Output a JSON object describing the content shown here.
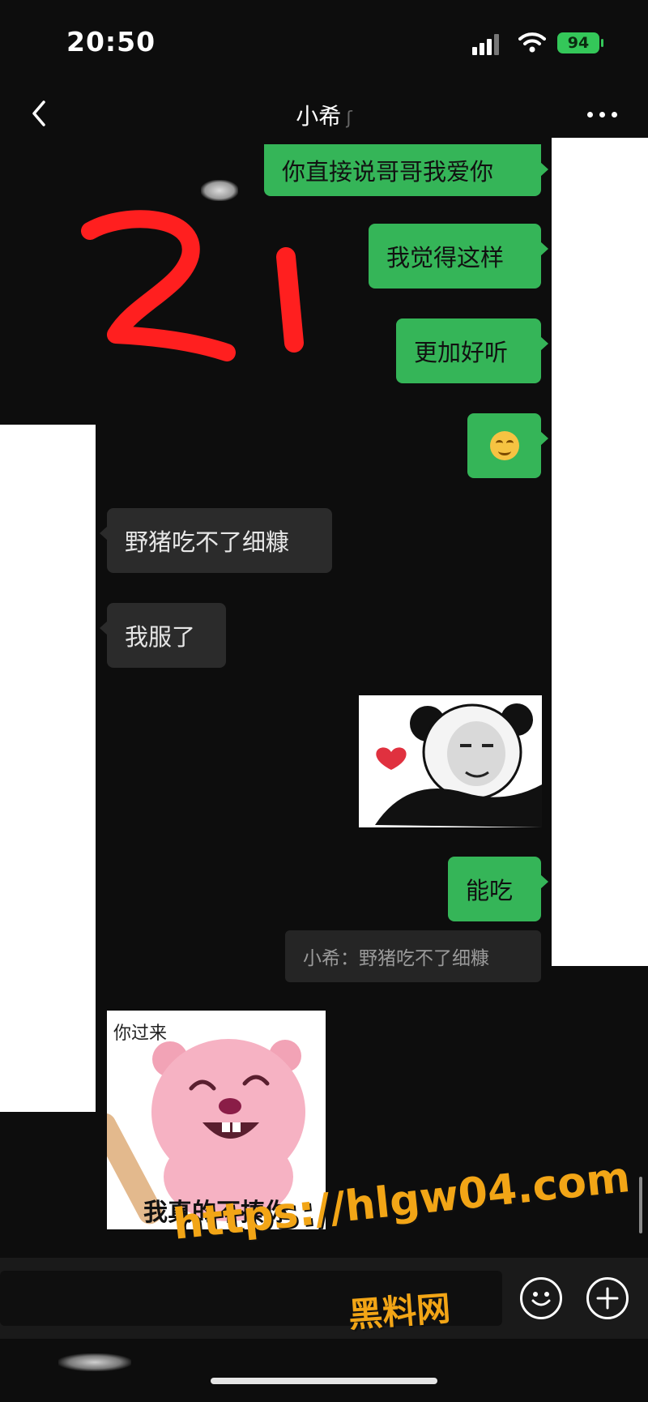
{
  "status": {
    "time": "20:50",
    "battery": "94"
  },
  "header": {
    "title": "小希"
  },
  "messages": [
    {
      "side": "out",
      "text": "你直接说哥哥我爱你"
    },
    {
      "side": "out",
      "text": "我觉得这样"
    },
    {
      "side": "out",
      "text": "更加好听"
    },
    {
      "side": "out",
      "emoji": "smiling-face-emoji"
    },
    {
      "side": "in",
      "text": "野猪吃不了细糠"
    },
    {
      "side": "in",
      "text": "我服了"
    },
    {
      "side": "out",
      "sticker": "panda-heart-sticker"
    },
    {
      "side": "out",
      "text": "能吃"
    },
    {
      "side": "in",
      "quote": "小希：野猪吃不了细糠"
    },
    {
      "side": "in",
      "sticker": "beaver-bat-sticker",
      "caption_top": "你过来",
      "caption_bottom": "我真的不揍你"
    }
  ],
  "annotation": {
    "text": "21",
    "color": "#ff1f1f"
  },
  "watermark": {
    "url": "https://hlgw04.com",
    "name": "黑料网",
    "color": "#f2a516"
  },
  "colors": {
    "outgoing_bubble": "#35b558",
    "incoming_bubble": "#2b2b2b",
    "background": "#0d0d0d"
  }
}
